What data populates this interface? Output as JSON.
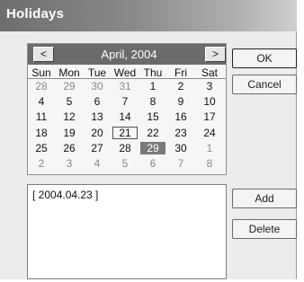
{
  "window": {
    "title": "Holidays"
  },
  "calendar": {
    "month_label": "April, 2004",
    "prev_label": "<",
    "next_label": ">",
    "weekdays": [
      "Sun",
      "Mon",
      "Tue",
      "Wed",
      "Thu",
      "Fri",
      "Sat"
    ],
    "weeks": [
      [
        {
          "d": "28",
          "other": true
        },
        {
          "d": "29",
          "other": true
        },
        {
          "d": "30",
          "other": true
        },
        {
          "d": "31",
          "other": true
        },
        {
          "d": "1"
        },
        {
          "d": "2"
        },
        {
          "d": "3"
        }
      ],
      [
        {
          "d": "4"
        },
        {
          "d": "5"
        },
        {
          "d": "6"
        },
        {
          "d": "7"
        },
        {
          "d": "8"
        },
        {
          "d": "9"
        },
        {
          "d": "10"
        }
      ],
      [
        {
          "d": "11"
        },
        {
          "d": "12"
        },
        {
          "d": "13"
        },
        {
          "d": "14"
        },
        {
          "d": "15"
        },
        {
          "d": "16"
        },
        {
          "d": "17"
        }
      ],
      [
        {
          "d": "18"
        },
        {
          "d": "19"
        },
        {
          "d": "20"
        },
        {
          "d": "21",
          "today": true
        },
        {
          "d": "22"
        },
        {
          "d": "23"
        },
        {
          "d": "24"
        }
      ],
      [
        {
          "d": "25"
        },
        {
          "d": "26"
        },
        {
          "d": "27"
        },
        {
          "d": "28"
        },
        {
          "d": "29",
          "selected": true
        },
        {
          "d": "30"
        },
        {
          "d": "1",
          "other": true
        }
      ],
      [
        {
          "d": "2",
          "other": true
        },
        {
          "d": "3",
          "other": true
        },
        {
          "d": "4",
          "other": true
        },
        {
          "d": "5",
          "other": true
        },
        {
          "d": "6",
          "other": true
        },
        {
          "d": "7",
          "other": true
        },
        {
          "d": "8",
          "other": true
        }
      ]
    ]
  },
  "holidays": [
    "[ 2004.04.23 ]"
  ],
  "buttons": {
    "ok": "OK",
    "cancel": "Cancel",
    "add": "Add",
    "delete": "Delete"
  }
}
